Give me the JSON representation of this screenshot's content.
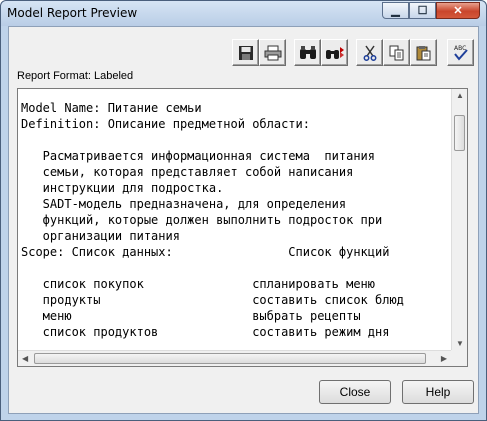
{
  "window": {
    "title": "Model Report Preview"
  },
  "report_format": "Report Format: Labeled",
  "toolbar": {
    "icons": [
      "save-icon",
      "print-icon",
      "find-icon",
      "find-replace-icon",
      "cut-icon",
      "copy-icon",
      "paste-icon",
      "spell-check-icon"
    ]
  },
  "report": {
    "lines": [
      "Model Name: Питание семьи",
      "Definition: Описание предметной области:",
      "",
      "   Расматривается информационная система  питания",
      "   семьи, которая представляет собой написания",
      "   инструкции для подростка.",
      "   SADT-модель предназначена, для определения",
      "   функций, которые должен выполнить подросток при",
      "   организации питания",
      "Scope: Список данных:                Список функций",
      "",
      "   список покупок               спланировать меню",
      "   продукты                     составить список блюд",
      "   меню                         выбрать рецепты",
      "   список продуктов             составить режим дня"
    ]
  },
  "buttons": {
    "close": "Close",
    "help": "Help"
  }
}
